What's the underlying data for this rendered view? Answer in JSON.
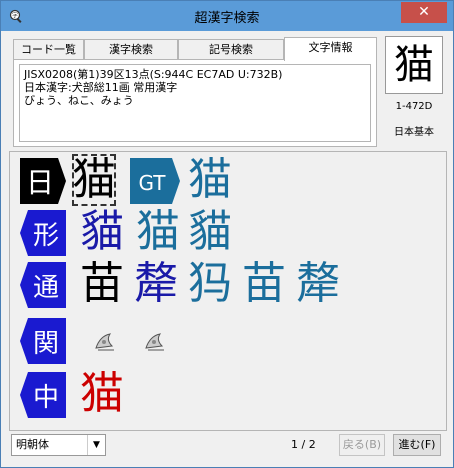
{
  "window": {
    "title": "超漢字検索",
    "close_glyph": "✕"
  },
  "tabs": [
    {
      "label": "コード一覧",
      "active": false
    },
    {
      "label": "漢字検索",
      "active": false
    },
    {
      "label": "記号検索",
      "active": false
    },
    {
      "label": "文字情報",
      "active": true
    }
  ],
  "info": {
    "line1": "JISX0208(第1)39区13点(S:944C EC7AD U:732B)",
    "line2": "日本漢字:犬部総11画 常用漢字",
    "line3": "びょう、ねこ、みょう"
  },
  "char_info": {
    "character": "猫",
    "code": "1-472D",
    "standard": "日本基本"
  },
  "glyph_rows": [
    {
      "tag": "日",
      "tag_color": "#000000",
      "glyphs": [
        "猫"
      ],
      "glyph_colors": [
        "#000000"
      ],
      "tag2": "GT",
      "tag2_color": "#1b6e9c",
      "glyphs2": [
        "猫"
      ],
      "glyph_colors2": [
        "#1b6e9c"
      ]
    },
    {
      "tag": "形",
      "tag_color": "#1a1ad0",
      "glyphs": [
        "貓",
        "猫",
        "貓"
      ],
      "glyph_colors": [
        "#1a1aa8",
        "#1b6e9c",
        "#1b6e9c"
      ]
    },
    {
      "tag": "通",
      "tag_color": "#1a1ad0",
      "glyphs": [
        "苗",
        "犛",
        "犸",
        "苗",
        "犛"
      ],
      "glyph_colors": [
        "#000000",
        "#1a1aa8",
        "#1b6e9c",
        "#1b6e9c",
        "#1b6e9c"
      ]
    },
    {
      "tag": "関",
      "tag_color": "#1a1ad0",
      "icons": [
        "bow-icon",
        "bow-icon"
      ]
    },
    {
      "tag": "中",
      "tag_color": "#1a1ad0",
      "glyphs": [
        "猫"
      ],
      "glyph_colors": [
        "#cc0000"
      ]
    }
  ],
  "bottom": {
    "font_value": "明朝体",
    "page_indicator": "1 / 2",
    "prev_label": "戻る(B)",
    "next_label": "進む(F)"
  }
}
